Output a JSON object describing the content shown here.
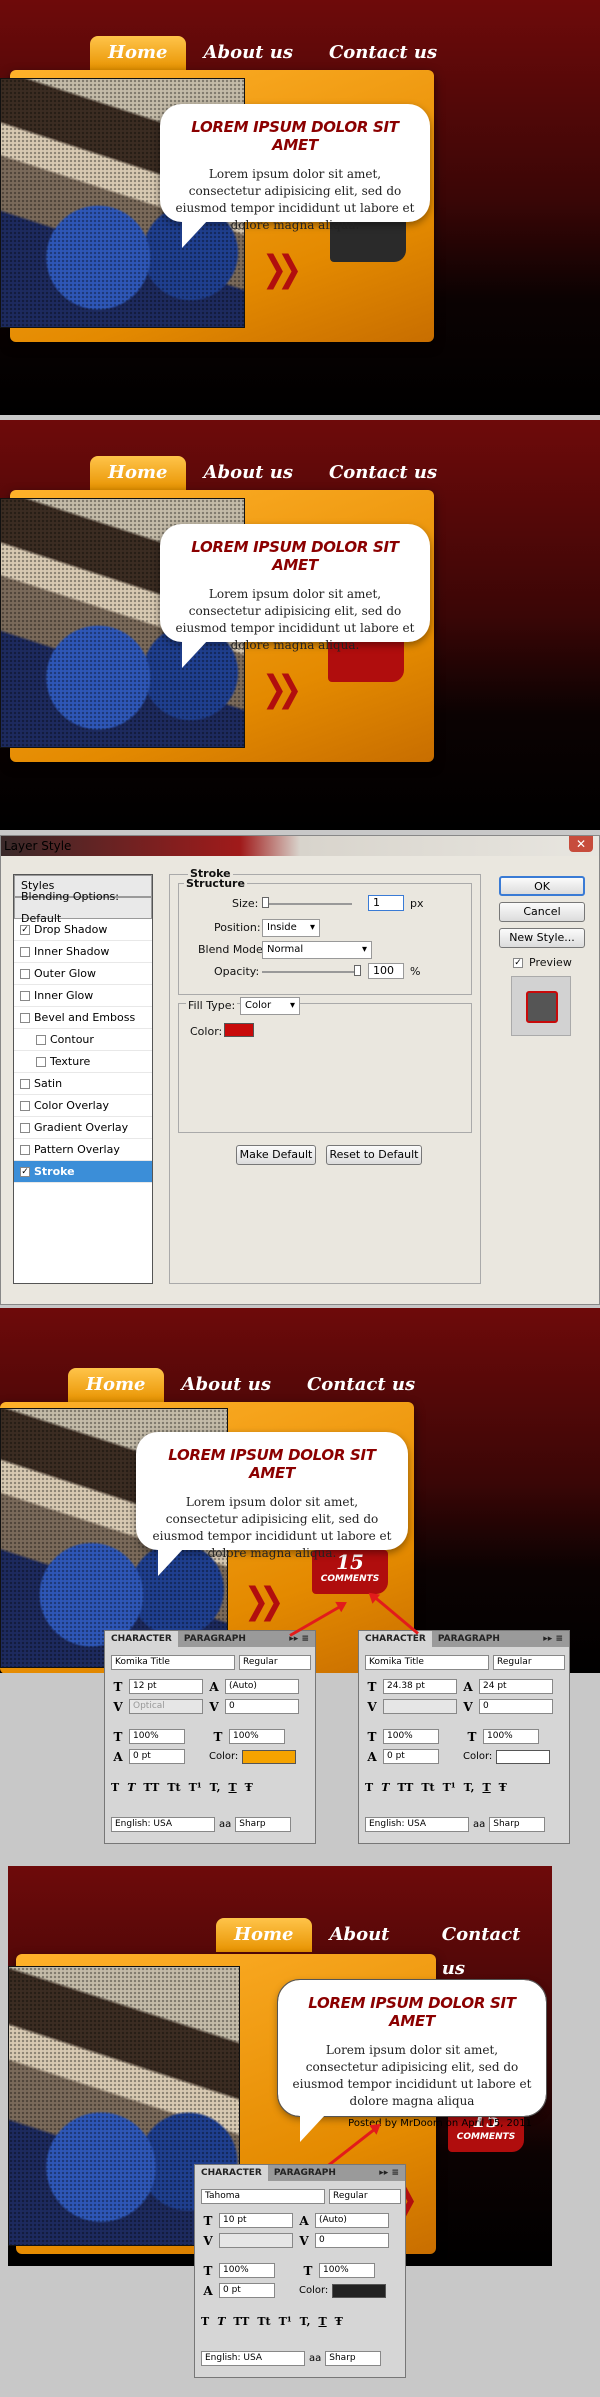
{
  "nav": {
    "home": "Home",
    "about": "About us",
    "contact": "Contact us"
  },
  "bubble": {
    "title": "LOREM IPSUM DOLOR SIT AMET",
    "body": "Lorem ipsum dolor sit amet, consectetur adipisicing elit, sed do eiusmod tempor incididunt ut labore et dolore magna aliqua.",
    "body4": "Lorem ipsum dolor sit amet, consectetur adipisicing elit, sed do eiusmod tempor incididunt ut labore et dolore magna aliqua",
    "posted": "Posted by MrDoom on April 15, 2011"
  },
  "comments": {
    "count": "15",
    "label": "COMMENTS"
  },
  "colors": {
    "tag_dark": "#2a2a2a",
    "tag_red": "#b00d0d",
    "accent_orange": "#f5a300",
    "stroke_color": "#c80a0a"
  },
  "dialog": {
    "title": "Layer Style",
    "list": [
      "Styles",
      "Blending Options: Default",
      "Drop Shadow",
      "Inner Shadow",
      "Outer Glow",
      "Inner Glow",
      "Bevel and Emboss",
      "Contour",
      "Texture",
      "Satin",
      "Color Overlay",
      "Gradient Overlay",
      "Pattern Overlay",
      "Stroke"
    ],
    "stroke_title": "Stroke",
    "structure": "Structure",
    "size_label": "Size:",
    "size_value": "1",
    "size_unit": "px",
    "position_label": "Position:",
    "position_value": "Inside",
    "blend_label": "Blend Mode:",
    "blend_value": "Normal",
    "opacity_label": "Opacity:",
    "opacity_value": "100",
    "opacity_unit": "%",
    "fill_label": "Fill Type:",
    "fill_value": "Color",
    "color_label": "Color:",
    "make_default": "Make Default",
    "reset_default": "Reset to Default",
    "ok": "OK",
    "cancel": "Cancel",
    "new_style": "New Style...",
    "preview": "Preview"
  },
  "char_panels": [
    {
      "tab1": "CHARACTER",
      "tab2": "PARAGRAPH",
      "font": "Komika Title",
      "style": "Regular",
      "size": "12 pt",
      "leading": "(Auto)",
      "kerning": "Optical",
      "tracking": "0",
      "vscale": "100%",
      "hscale": "100%",
      "baseline": "0 pt",
      "color_label": "Color:",
      "lang": "English: USA",
      "aa_label": "aa",
      "aa": "Sharp"
    },
    {
      "tab1": "CHARACTER",
      "tab2": "PARAGRAPH",
      "font": "Komika Title",
      "style": "Regular",
      "size": "24.38 pt",
      "leading": "24 pt",
      "kerning": "",
      "tracking": "0",
      "vscale": "100%",
      "hscale": "100%",
      "baseline": "0 pt",
      "color_label": "Color:",
      "lang": "English: USA",
      "aa_label": "aa",
      "aa": "Sharp"
    },
    {
      "tab1": "CHARACTER",
      "tab2": "PARAGRAPH",
      "font": "Tahoma",
      "style": "Regular",
      "size": "10 pt",
      "leading": "(Auto)",
      "kerning": "",
      "tracking": "0",
      "vscale": "100%",
      "hscale": "100%",
      "baseline": "0 pt",
      "color_label": "Color:",
      "lang": "English: USA",
      "aa_label": "aa",
      "aa": "Sharp"
    }
  ],
  "char_tools": [
    "T",
    "T",
    "TT",
    "Tt",
    "T¹",
    "T,",
    "T",
    "Ŧ"
  ]
}
